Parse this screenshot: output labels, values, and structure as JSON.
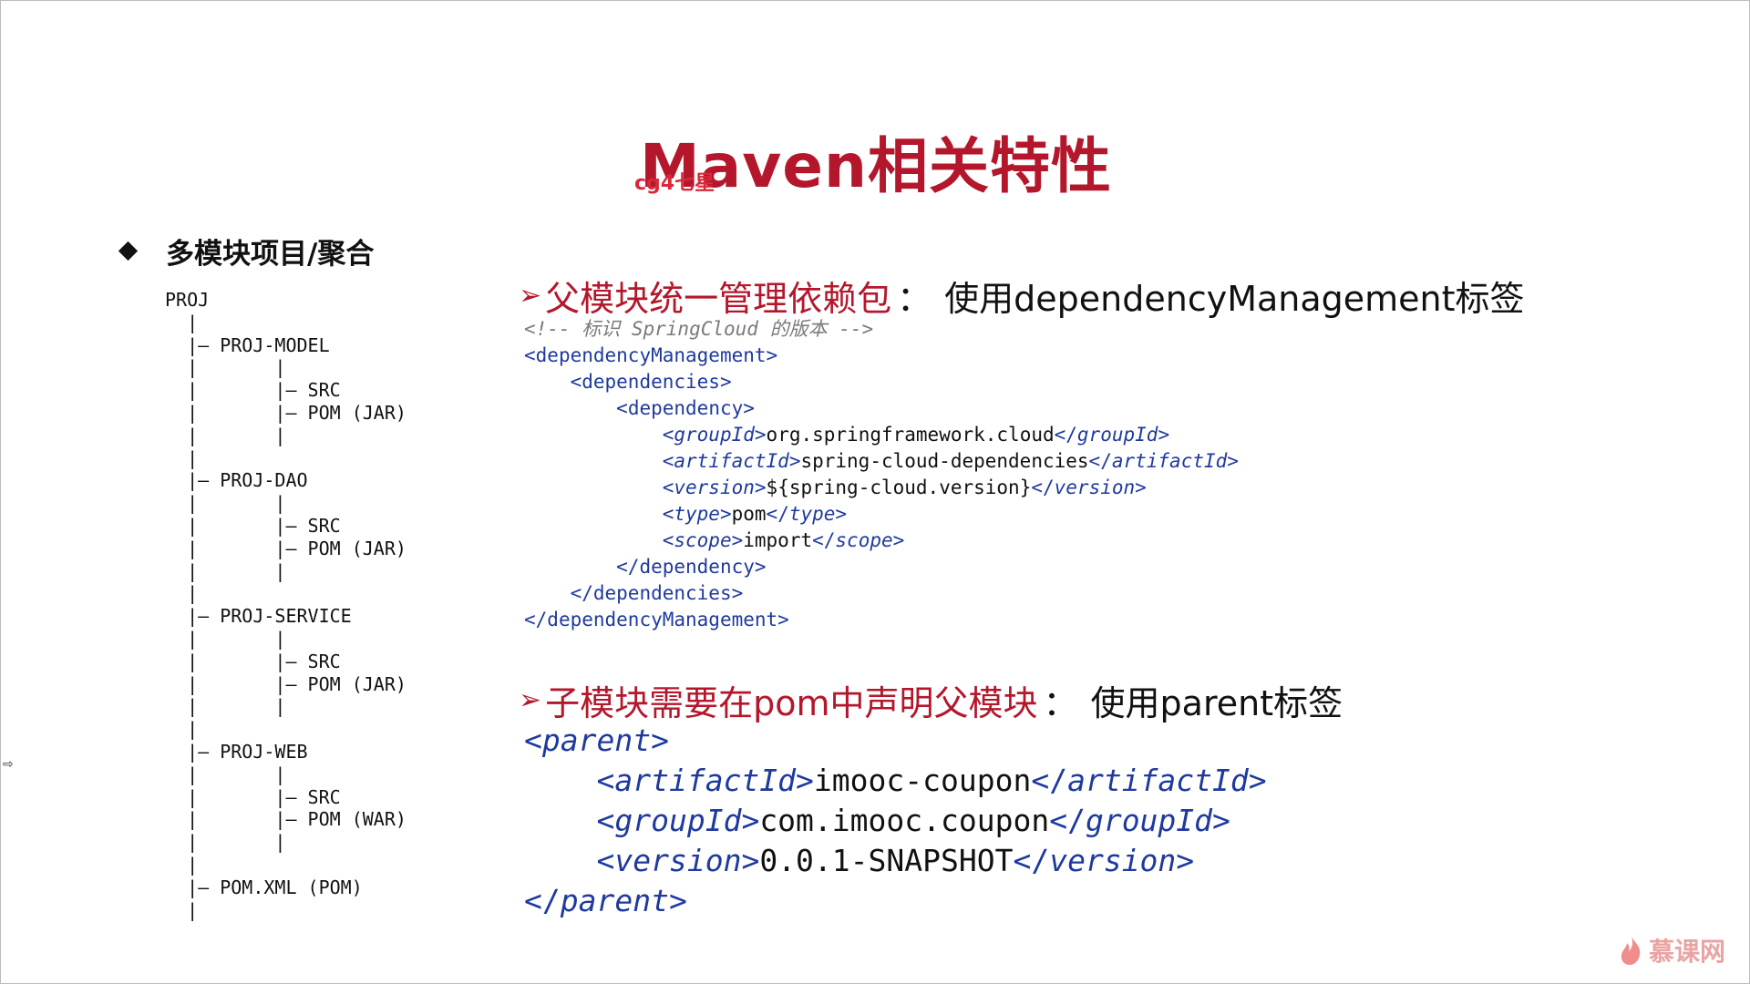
{
  "title": "Maven相关特性",
  "watermark_small": "cg4七星",
  "left": {
    "heading": "多模块项目/聚合",
    "tree": "PROJ\n  |\n  |— PROJ-MODEL\n  |       |\n  |       |— SRC\n  |       |— POM (JAR)\n  |       |\n  |\n  |— PROJ-DAO\n  |       |\n  |       |— SRC\n  |       |— POM (JAR)\n  |       |\n  |\n  |— PROJ-SERVICE\n  |       |\n  |       |— SRC\n  |       |— POM (JAR)\n  |       |\n  |\n  |— PROJ-WEB\n  |       |\n  |       |— SRC\n  |       |— POM (WAR)\n  |       |\n  |\n  |— POM.XML (POM)\n  |"
  },
  "section1": {
    "arrow": "➢",
    "red_text": "父模块统一管理依赖包",
    "separator": "：",
    "black_text": "使用dependencyManagement标签",
    "code": {
      "comment": "<!-- 标识 SpringCloud 的版本 -->",
      "dm_open": "dependencyManagement",
      "deps_open": "dependencies",
      "dep_open": "dependency",
      "groupId_tag": "groupId",
      "groupId_value": "org.springframework.cloud",
      "artifactId_tag": "artifactId",
      "artifactId_value": "spring-cloud-dependencies",
      "version_tag": "version",
      "version_value": "${spring-cloud.version}",
      "type_tag": "type",
      "type_value": "pom",
      "scope_tag": "scope",
      "scope_value": "import"
    }
  },
  "section2": {
    "arrow": "➢",
    "red_text": "子模块需要在pom中声明父模块",
    "separator": "：",
    "black_text": "使用parent标签",
    "code": {
      "parent_tag": "parent",
      "artifactId_tag": "artifactId",
      "artifactId_value": "imooc-coupon",
      "groupId_tag": "groupId",
      "groupId_value": "com.imooc.coupon",
      "version_tag": "version",
      "version_value": "0.0.1-SNAPSHOT"
    }
  },
  "logo": {
    "icon": "flame-icon",
    "text": "慕课网"
  },
  "colors": {
    "title_red": "#b4172c",
    "tag_blue": "#1f3a9e",
    "comment_gray": "#7a7a7a",
    "logo_pink": "#e9a4a4"
  }
}
